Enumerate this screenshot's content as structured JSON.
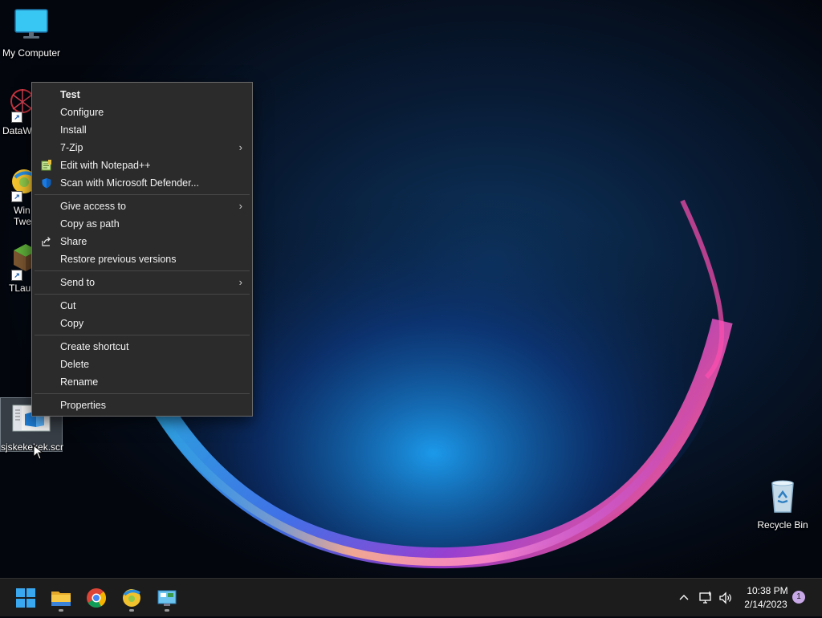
{
  "desktop": {
    "icons": [
      {
        "label": "My Computer"
      },
      {
        "label": "DataW"
      },
      {
        "label": "Win Twe"
      },
      {
        "label": "TLaun"
      },
      {
        "label": "sjskekekek.scr"
      },
      {
        "label": "Recycle Bin"
      }
    ],
    "win_label_line1": "Win",
    "win_label_line2": "Twe"
  },
  "context_menu": {
    "items": [
      {
        "label": "Test"
      },
      {
        "label": "Configure"
      },
      {
        "label": "Install"
      },
      {
        "label": "7-Zip"
      },
      {
        "label": "Edit with Notepad++",
        "icon": "notepad-plus-plus-icon"
      },
      {
        "label": "Scan with Microsoft Defender...",
        "icon": "defender-shield-icon"
      },
      {
        "label": "Give access to"
      },
      {
        "label": "Copy as path"
      },
      {
        "label": "Share",
        "icon": "share-icon"
      },
      {
        "label": "Restore previous versions"
      },
      {
        "label": "Send to"
      },
      {
        "label": "Cut"
      },
      {
        "label": "Copy"
      },
      {
        "label": "Create shortcut"
      },
      {
        "label": "Delete"
      },
      {
        "label": "Rename"
      },
      {
        "label": "Properties"
      }
    ],
    "chevron": "›"
  },
  "taskbar": {
    "apps": [
      "start-icon",
      "file-explorer-icon",
      "chrome-icon",
      "winaero-tweaker-icon",
      "control-panel-icon"
    ],
    "tray": {
      "time": "10:38 PM",
      "date": "2/14/2023",
      "notification_count": "1"
    }
  },
  "colors": {
    "menu_bg": "#2b2b2b",
    "taskbar_bg": "#1c1c1c",
    "accent": "#0a84ff"
  }
}
